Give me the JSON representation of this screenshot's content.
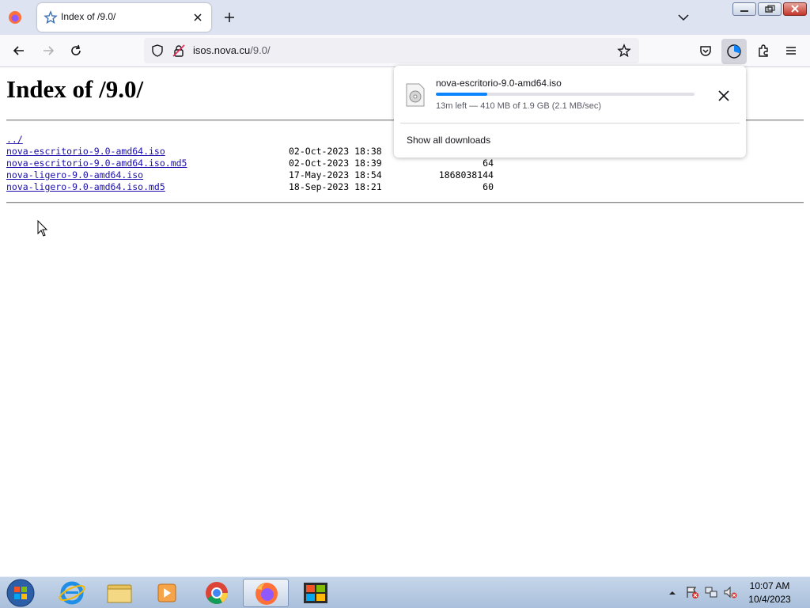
{
  "browser": {
    "tab_title": "Index of /9.0/",
    "url_host": "isos.nova.cu",
    "url_path": "/9.0/"
  },
  "page": {
    "heading": "Index of /9.0/",
    "entries": [
      {
        "name": "../",
        "date": "",
        "size": ""
      },
      {
        "name": "nova-escritorio-9.0-amd64.iso",
        "date": "02-Oct-2023 18:38",
        "size": ""
      },
      {
        "name": "nova-escritorio-9.0-amd64.iso.md5",
        "date": "02-Oct-2023 18:39",
        "size": "64"
      },
      {
        "name": "nova-ligero-9.0-amd64.iso",
        "date": "17-May-2023 18:54",
        "size": "1868038144"
      },
      {
        "name": "nova-ligero-9.0-amd64.iso.md5",
        "date": "18-Sep-2023 18:21",
        "size": "60"
      }
    ]
  },
  "downloads": {
    "filename": "nova-escritorio-9.0-amd64.iso",
    "progress_fraction": 0.2,
    "status": "13m left — 410 MB of 1.9 GB (2.1 MB/sec)",
    "show_all": "Show all downloads"
  },
  "taskbar": {
    "time": "10:07 AM",
    "date": "10/4/2023"
  },
  "colors": {
    "accent": "#0a84ff",
    "link": "#1a0dab",
    "taskbar": "#b7cbe3"
  }
}
